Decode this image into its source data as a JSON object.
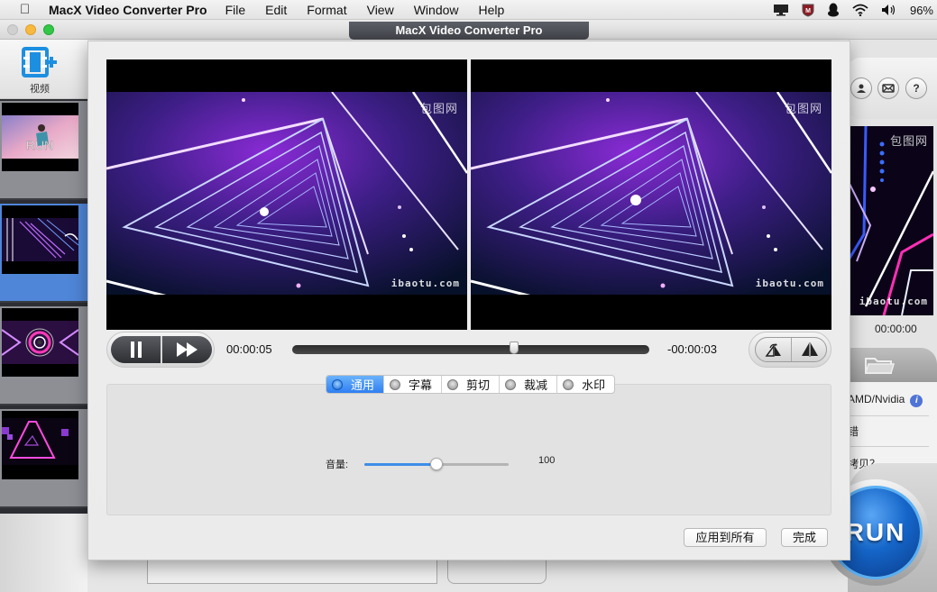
{
  "menubar": {
    "app_name": "MacX Video Converter Pro",
    "items": [
      "File",
      "Edit",
      "Format",
      "View",
      "Window",
      "Help"
    ],
    "tray": {
      "icons": [
        "display-icon",
        "mcafee-shield-icon",
        "qq-penguin-icon",
        "wifi-icon",
        "volume-icon"
      ],
      "battery": "96%"
    }
  },
  "window": {
    "title": "MacX Video Converter Pro"
  },
  "toolbar": {
    "add_video_label": "视频"
  },
  "thumbnails": [
    {
      "name": "run-video",
      "selected": false
    },
    {
      "name": "neon-tunnel-video",
      "selected": true
    },
    {
      "name": "neon-circle-video",
      "selected": false
    },
    {
      "name": "neon-triangle-video",
      "selected": false
    }
  ],
  "right_panel": {
    "preview_time": "00:00:00",
    "watermark_cn": "包图网",
    "watermark_en": "ibaotu.com",
    "hw_accel_label": "AMD/Nvidia",
    "row2_label": "错",
    "row3_label": "拷贝？",
    "run_label": "RUN"
  },
  "dialog": {
    "watermark_cn": "包图网",
    "watermark_en": "ibaotu.com",
    "playback": {
      "current_time": "00:00:05",
      "remaining_time": "-00:00:03",
      "progress_fraction": 0.62
    },
    "tabs": [
      {
        "label": "通用",
        "active": true
      },
      {
        "label": "字幕",
        "active": false
      },
      {
        "label": "剪切",
        "active": false
      },
      {
        "label": "裁减",
        "active": false
      },
      {
        "label": "水印",
        "active": false
      }
    ],
    "volume": {
      "label": "音量:",
      "value": "100",
      "fraction": 0.5
    },
    "buttons": {
      "apply_all": "应用到所有",
      "done": "完成"
    }
  }
}
